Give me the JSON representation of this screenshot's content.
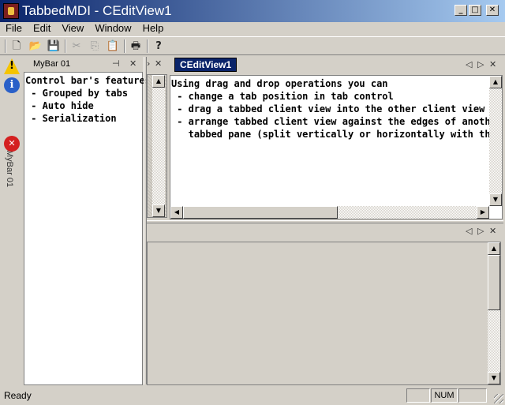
{
  "window": {
    "title": "TabbedMDI - CEditView1",
    "min_glyph": "_",
    "max_glyph": "□",
    "close_glyph": "✕"
  },
  "menu": [
    "File",
    "Edit",
    "View",
    "Window",
    "Help"
  ],
  "toolbar": {
    "buttons": [
      "new-document-icon",
      "open-folder-icon",
      "save-icon",
      "cut-icon",
      "copy-icon",
      "paste-icon",
      "print-icon",
      "help-icon"
    ],
    "glyphs": {
      "new": "🗋",
      "open": "📂",
      "save": "💾",
      "cut": "✂",
      "copy": "⎘",
      "paste": "📋",
      "print": "🖶",
      "help": "?"
    }
  },
  "autohide_bar": {
    "label": "MyBar 01",
    "icons": [
      "warning-icon",
      "info-icon",
      "error-icon"
    ],
    "glyphs": {
      "warning": "!",
      "info": "i",
      "error": "✕"
    }
  },
  "mybar": {
    "tab_label": "MyBar 01",
    "pin_glyph": "⊣",
    "close_glyph": "✕",
    "lines": [
      "Control bar's features:",
      " - Grouped by tabs",
      " - Auto hide",
      " - Serialization"
    ]
  },
  "left_pane": {
    "nav_glyph": "›",
    "close_glyph": "✕"
  },
  "editor": {
    "tab_label": "CEditView1",
    "prev_glyph": "◁",
    "next_glyph": "▷",
    "close_glyph": "✕",
    "lines": [
      "Using drag and drop operations you can",
      " - change a tab position in tab control",
      " - drag a tabbed client view into the other client view pane",
      " - arrange tabbed client view against the edges of another",
      "   tabbed pane (split vertically or horizontally with the others)"
    ]
  },
  "bottom_pane": {
    "prev_glyph": "◁",
    "next_glyph": "▷",
    "close_glyph": "✕"
  },
  "scroll": {
    "up": "▲",
    "down": "▼",
    "left": "◀",
    "right": "▶"
  },
  "statusbar": {
    "text": "Ready",
    "num": "NUM"
  },
  "colors": {
    "title_start": "#0a246a",
    "title_end": "#a6caf0",
    "face": "#d4d0c8",
    "active_tab": "#0a246a"
  }
}
